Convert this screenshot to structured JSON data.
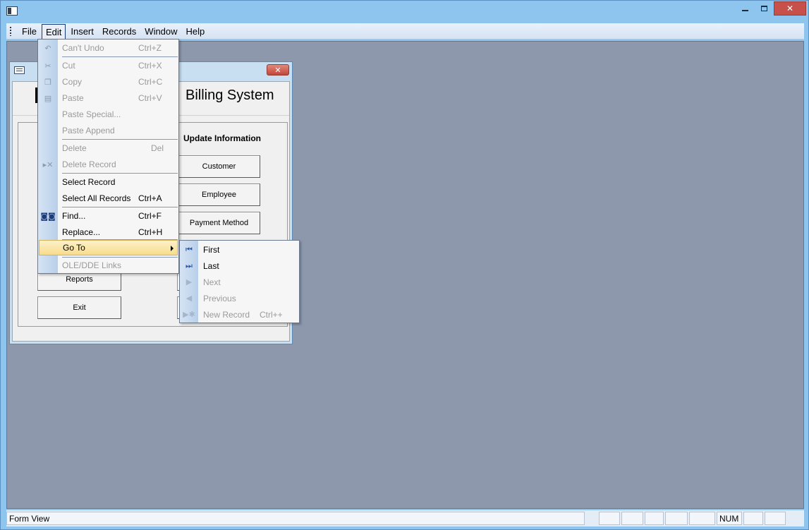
{
  "menubar": {
    "items": [
      "File",
      "Edit",
      "Insert",
      "Records",
      "Window",
      "Help"
    ]
  },
  "form": {
    "title": "Billing System",
    "section_label": "Update Information",
    "buttons": {
      "customer": "Customer",
      "employee": "Employee",
      "payment": "Payment Method",
      "reports": "Reports",
      "exit": "Exit"
    }
  },
  "edit_menu": {
    "items": [
      {
        "label": "Can't Undo",
        "shortcut": "Ctrl+Z",
        "icon": "undo-icon"
      },
      {
        "label": "Cut",
        "shortcut": "Ctrl+X",
        "icon": "scissors-icon"
      },
      {
        "label": "Copy",
        "shortcut": "Ctrl+C",
        "icon": "copy-icon"
      },
      {
        "label": "Paste",
        "shortcut": "Ctrl+V",
        "icon": "paste-icon"
      },
      {
        "label": "Paste Special...",
        "shortcut": ""
      },
      {
        "label": "Paste Append",
        "shortcut": ""
      },
      {
        "label": "Delete",
        "shortcut": "Del"
      },
      {
        "label": "Delete Record",
        "shortcut": "",
        "icon": "delete-record-icon"
      },
      {
        "label": "Select Record",
        "shortcut": ""
      },
      {
        "label": "Select All Records",
        "shortcut": "Ctrl+A"
      },
      {
        "label": "Find...",
        "shortcut": "Ctrl+F",
        "icon": "binoculars-icon"
      },
      {
        "label": "Replace...",
        "shortcut": "Ctrl+H"
      },
      {
        "label": "Go To",
        "shortcut": ""
      },
      {
        "label": "OLE/DDE Links",
        "shortcut": ""
      }
    ]
  },
  "goto_submenu": {
    "items": [
      {
        "label": "First",
        "shortcut": "",
        "icon": "first-record-icon"
      },
      {
        "label": "Last",
        "shortcut": "",
        "icon": "last-record-icon"
      },
      {
        "label": "Next",
        "shortcut": "",
        "icon": "next-record-icon"
      },
      {
        "label": "Previous",
        "shortcut": "",
        "icon": "previous-record-icon"
      },
      {
        "label": "New Record",
        "shortcut": "Ctrl++",
        "icon": "new-record-icon"
      }
    ]
  },
  "statusbar": {
    "mode": "Form View",
    "num": "NUM"
  }
}
